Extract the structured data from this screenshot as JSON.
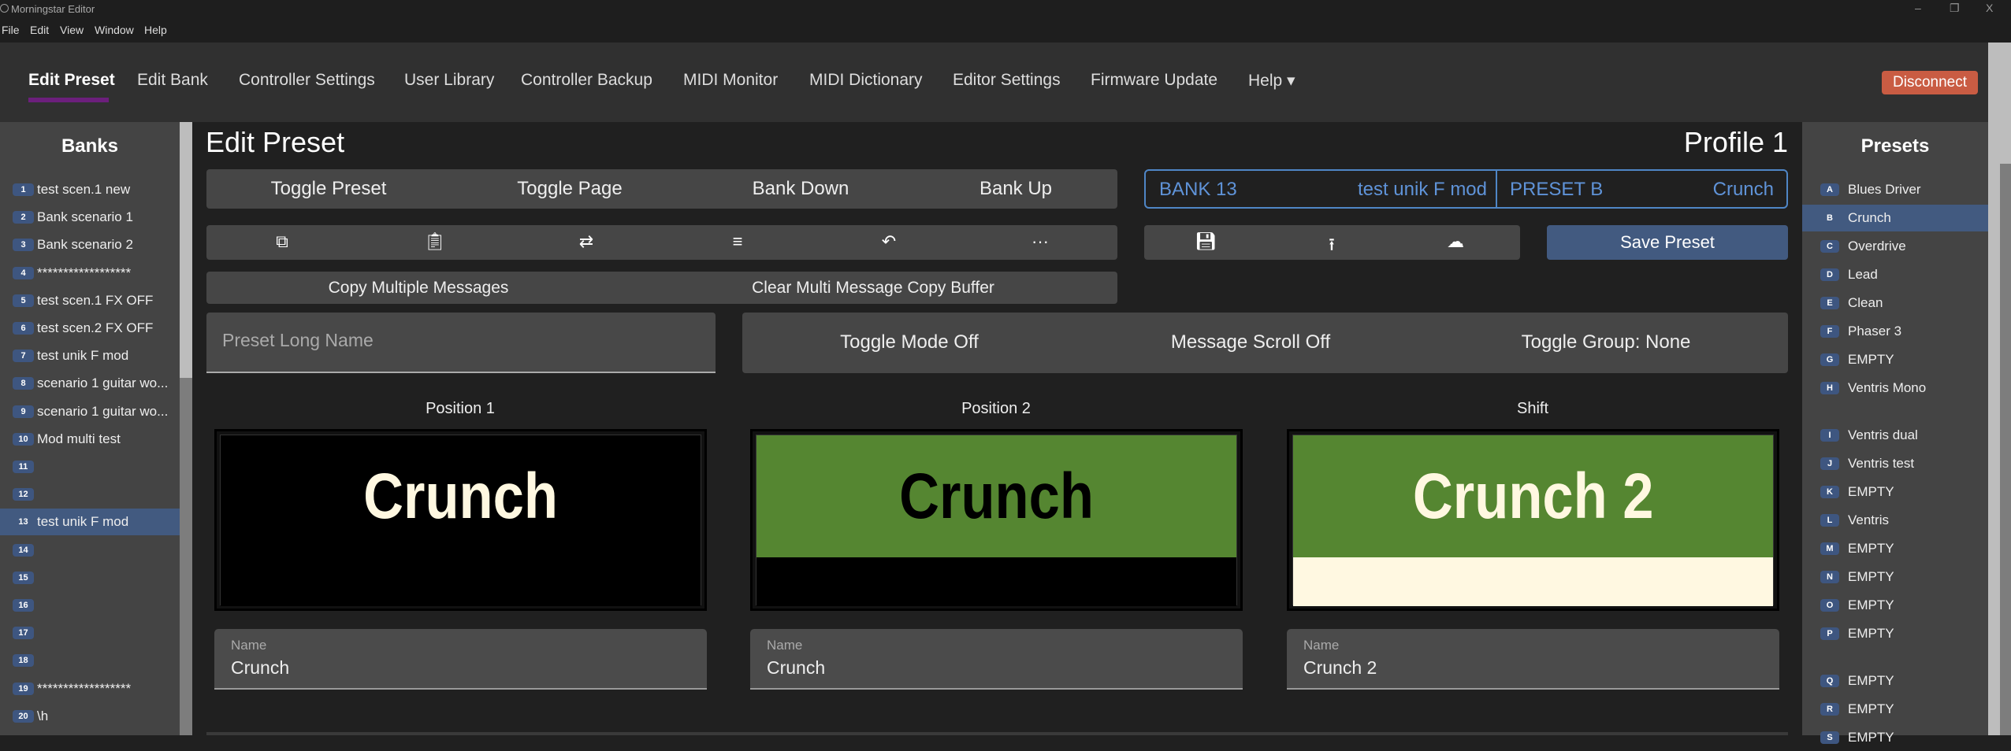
{
  "window": {
    "title": "Morningstar Editor",
    "controls": [
      "–",
      "❐",
      "X"
    ]
  },
  "menu": [
    "File",
    "Edit",
    "View",
    "Window",
    "Help"
  ],
  "nav": {
    "items": [
      "Edit Preset",
      "Edit Bank",
      "Controller Settings",
      "User Library",
      "Controller Backup",
      "MIDI Monitor",
      "MIDI Dictionary",
      "Editor Settings",
      "Firmware Update",
      "Help ▾"
    ],
    "active": 0,
    "disconnect": "Disconnect"
  },
  "banks": {
    "title": "Banks",
    "selected": 13,
    "items": [
      {
        "n": "1",
        "name": "test scen.1 new"
      },
      {
        "n": "2",
        "name": "Bank scenario 1"
      },
      {
        "n": "3",
        "name": "Bank scenario 2"
      },
      {
        "n": "4",
        "name": "******************"
      },
      {
        "n": "5",
        "name": "test scen.1 FX OFF"
      },
      {
        "n": "6",
        "name": "test scen.2 FX OFF"
      },
      {
        "n": "7",
        "name": "test unik F mod"
      },
      {
        "n": "8",
        "name": "scenario 1 guitar wo..."
      },
      {
        "n": "9",
        "name": "scenario 1 guitar wo..."
      },
      {
        "n": "10",
        "name": "Mod multi test"
      },
      {
        "n": "11",
        "name": ""
      },
      {
        "n": "12",
        "name": ""
      },
      {
        "n": "13",
        "name": "test unik F mod"
      },
      {
        "n": "14",
        "name": ""
      },
      {
        "n": "15",
        "name": ""
      },
      {
        "n": "16",
        "name": ""
      },
      {
        "n": "17",
        "name": ""
      },
      {
        "n": "18",
        "name": ""
      },
      {
        "n": "19",
        "name": "******************"
      },
      {
        "n": "20",
        "name": "\\h"
      }
    ]
  },
  "presets": {
    "title": "Presets",
    "selected": "B",
    "items": [
      {
        "n": "A",
        "name": "Blues Driver"
      },
      {
        "n": "B",
        "name": "Crunch"
      },
      {
        "n": "C",
        "name": "Overdrive"
      },
      {
        "n": "D",
        "name": "Lead"
      },
      {
        "n": "E",
        "name": "Clean"
      },
      {
        "n": "F",
        "name": "Phaser 3"
      },
      {
        "n": "G",
        "name": "EMPTY"
      },
      {
        "n": "H",
        "name": "Ventris Mono"
      },
      {
        "n": "I",
        "name": "Ventris dual"
      },
      {
        "n": "J",
        "name": "Ventris test"
      },
      {
        "n": "K",
        "name": "EMPTY"
      },
      {
        "n": "L",
        "name": "Ventris"
      },
      {
        "n": "M",
        "name": "EMPTY"
      },
      {
        "n": "N",
        "name": "EMPTY"
      },
      {
        "n": "O",
        "name": "EMPTY"
      },
      {
        "n": "P",
        "name": "EMPTY"
      },
      {
        "n": "Q",
        "name": "EMPTY"
      },
      {
        "n": "R",
        "name": "EMPTY"
      },
      {
        "n": "S",
        "name": "EMPTY"
      }
    ]
  },
  "main": {
    "title": "Edit Preset",
    "profile": "Profile 1",
    "actions": [
      "Toggle Preset",
      "Toggle Page",
      "Bank Down",
      "Bank Up"
    ],
    "tools": [
      "copy-icon",
      "paste-icon",
      "swap-icon",
      "list-icon",
      "undo-icon",
      "more-icon"
    ],
    "bank_label": "BANK 13",
    "bank_name": "test unik F mod",
    "preset_label": "PRESET B",
    "preset_name": "Crunch",
    "file_tools": [
      "save-icon",
      "upload-icon",
      "cloud-icon"
    ],
    "save": "Save Preset",
    "multi": [
      "Copy Multiple Messages",
      "Clear Multi Message Copy Buffer"
    ],
    "long_name_placeholder": "Preset Long Name",
    "toggles": [
      "Toggle Mode Off",
      "Message Scroll Off",
      "Toggle Group: None"
    ],
    "positions": [
      {
        "label": "Position 1",
        "text": "Crunch",
        "field_label": "Name",
        "value": "Crunch",
        "top": "#000000",
        "text_color": "#fff8e1",
        "bottom": "#000000"
      },
      {
        "label": "Position 2",
        "text": "Crunch",
        "field_label": "Name",
        "value": "Crunch",
        "top": "#558631",
        "text_color": "#000000",
        "bottom": "#000000"
      },
      {
        "label": "Shift",
        "text": "Crunch 2",
        "field_label": "Name",
        "value": "Crunch 2",
        "top": "#558631",
        "text_color": "#fff8e1",
        "bottom": "#fff8e1"
      }
    ]
  }
}
